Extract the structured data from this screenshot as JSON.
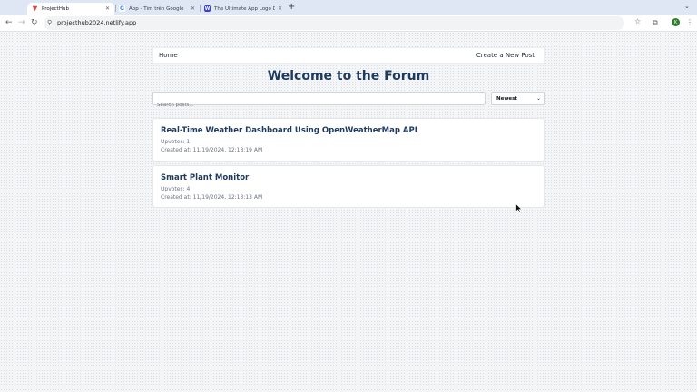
{
  "browser": {
    "tabs": [
      {
        "title": "ProjectHub",
        "favicon": "vercel-triangle-icon",
        "active": true
      },
      {
        "title": "App - Tìm trên Google",
        "favicon": "google-icon",
        "active": false
      },
      {
        "title": "The Ultimate App Logo Desi...",
        "favicon": "site-icon",
        "active": false
      }
    ],
    "url": "projecthub2024.netlify.app",
    "avatar_letter": "K"
  },
  "nav": {
    "home": "Home",
    "create": "Create a New Post"
  },
  "page": {
    "title": "Welcome to the Forum"
  },
  "search": {
    "placeholder": "Search posts..."
  },
  "sort": {
    "selected": "Newest"
  },
  "posts": [
    {
      "title": "Real-Time Weather Dashboard Using OpenWeatherMap API",
      "upvotes": "Upvotes: 1",
      "created": "Created at: 11/19/2024, 12:18:19 AM"
    },
    {
      "title": "Smart Plant Monitor",
      "upvotes": "Upvotes: 4",
      "created": "Created at: 11/19/2024, 12:13:13 AM"
    }
  ],
  "colors": {
    "heading": "#1e3a5f",
    "meta": "#6b7280",
    "tab_strip": "#dfe7f4"
  }
}
